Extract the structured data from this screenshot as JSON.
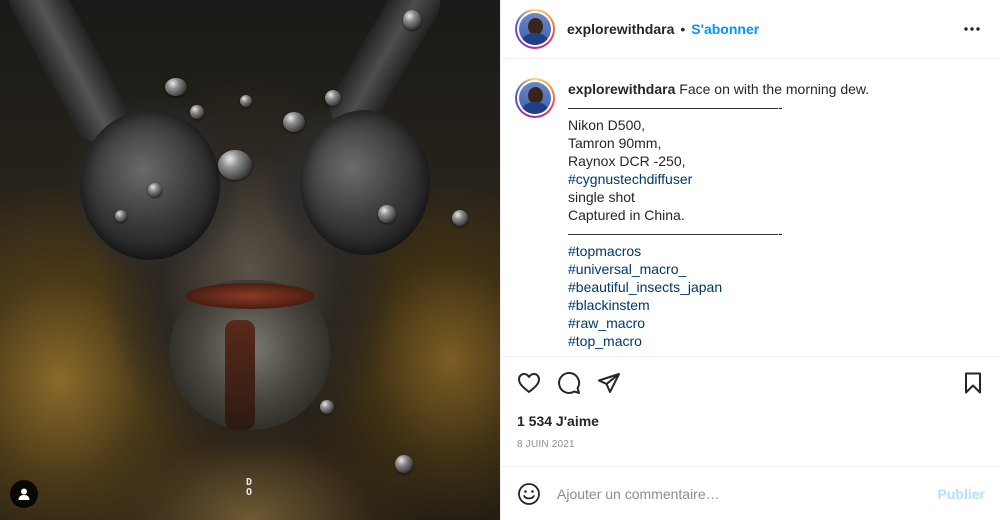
{
  "post": {
    "username": "explorewithdara",
    "separator": "•",
    "follow_label": "S'abonner"
  },
  "caption": {
    "username": "explorewithdara",
    "lines": [
      "Face on with the morning dew.",
      "———————————————-",
      "Nikon D500,",
      "Tamron 90mm,",
      "Raynox DCR -250,",
      "#cygnustechdiffuser",
      "single shot",
      "Captured in China.",
      "———————————————-",
      "#topmacros",
      "#universal_macro_",
      "#beautiful_insects_japan",
      "#blackinstem",
      "#raw_macro",
      "#top_macro"
    ]
  },
  "actions": {
    "like_icon": "heart-icon",
    "comment_icon": "comment-icon",
    "share_icon": "paper-plane-icon",
    "save_icon": "bookmark-icon"
  },
  "likes_text": "1 534 J'aime",
  "date_text": "8 JUIN 2021",
  "comment": {
    "placeholder": "Ajouter un commentaire…",
    "publish_label": "Publier"
  },
  "photo": {
    "watermark": "DO",
    "tag_icon": "user-tag-icon"
  },
  "colors": {
    "accent": "#0095f6",
    "hashtag": "#00376b",
    "publish_disabled": "#b2dffc",
    "muted": "#8e8e8e"
  }
}
